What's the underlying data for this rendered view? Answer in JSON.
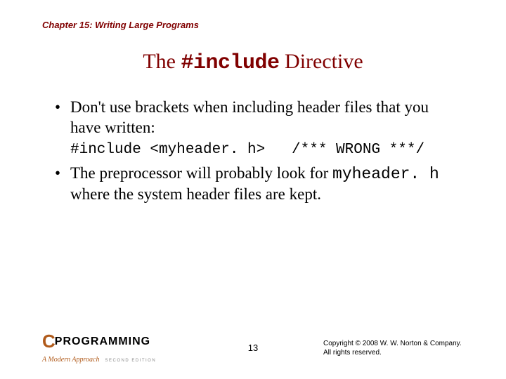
{
  "chapter": "Chapter 15: Writing Large Programs",
  "title_pre": "The ",
  "title_code": "#include",
  "title_post": " Directive",
  "bullet1": "Don't use brackets when including header files that you have written:",
  "code_line": "#include <myheader. h>   /*** WRONG ***/",
  "bullet2_pre": "The preprocessor will probably look for ",
  "bullet2_code": "myheader. h",
  "bullet2_post": " where the system header files are kept.",
  "logo_c": "C",
  "logo_text": "PROGRAMMING",
  "logo_sub": "A Modern Approach",
  "logo_edition": "SECOND EDITION",
  "page_number": "13",
  "copyright_line1": "Copyright © 2008 W. W. Norton & Company.",
  "copyright_line2": "All rights reserved."
}
